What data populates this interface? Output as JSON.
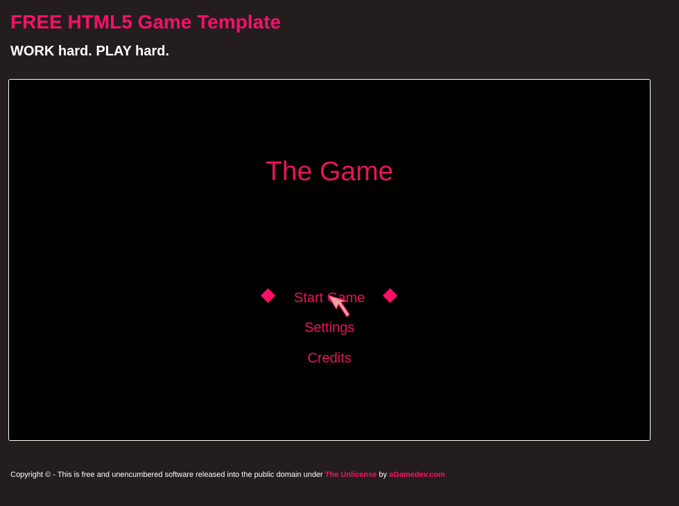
{
  "header": {
    "title": "FREE HTML5 Game Template",
    "tagline": "WORK hard. PLAY hard."
  },
  "game": {
    "title": "The Game",
    "menu": {
      "start": "Start Game",
      "settings": "Settings",
      "credits": "Credits"
    },
    "selected_item": "Start Game"
  },
  "footer": {
    "text_prefix": "Copyright © - This is free and unencumbered software released into the public domain under ",
    "license_link": "The Unlicense",
    "text_by": " by ",
    "author_link": "aGamedev.com"
  },
  "colors": {
    "page_background": "#231d1e",
    "accent": "#f7106a",
    "menu_text": "#e8145e",
    "canvas_background": "#000000"
  },
  "icons": {
    "selection_marker": "diamond",
    "pointer": "arrow-cursor"
  }
}
